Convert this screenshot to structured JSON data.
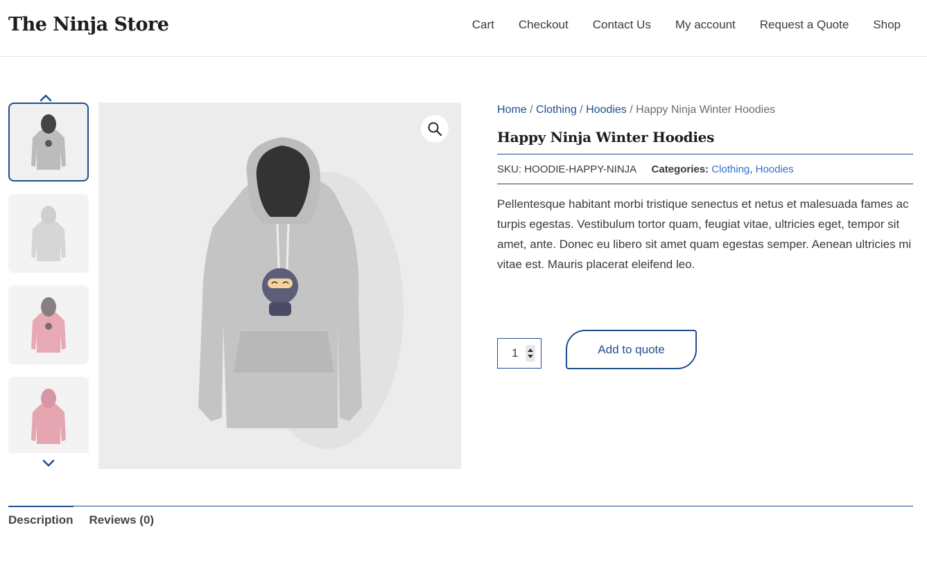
{
  "site": {
    "title": "The Ninja Store"
  },
  "nav": {
    "items": [
      "Cart",
      "Checkout",
      "Contact Us",
      "My account",
      "Request a Quote",
      "Shop"
    ]
  },
  "gallery": {
    "thumbnails": [
      {
        "color": "#bcbcbc",
        "hood": "#444444",
        "label": "grey hoodie with ninja"
      },
      {
        "color": "#d6d6d6",
        "hood": "#cfcfcf",
        "label": "grey hoodie back"
      },
      {
        "color": "#e8a8b4",
        "hood": "#8a7f80",
        "label": "pink hoodie with ninja"
      },
      {
        "color": "#e5a6b1",
        "hood": "#d796a3",
        "label": "pink hoodie back"
      }
    ],
    "main_hoodie_color": "#c4c4c4"
  },
  "breadcrumb": {
    "home": "Home",
    "clothing": "Clothing",
    "hoodies": "Hoodies",
    "current": "Happy Ninja Winter Hoodies",
    "sep": " / "
  },
  "product": {
    "title": "Happy Ninja Winter Hoodies",
    "sku_label": "SKU:",
    "sku": "HOODIE-HAPPY-NINJA",
    "categories_label": "Categories:",
    "categories": [
      "Clothing",
      "Hoodies"
    ],
    "categories_sep": ", ",
    "description": "Pellentesque habitant morbi tristique senectus et netus et malesuada fames ac turpis egestas. Vestibulum tortor quam, feugiat vitae, ultricies eget, tempor sit amet, ante. Donec eu libero sit amet quam egestas semper. Aenean ultricies mi vitae est. Mauris placerat eleifend leo.",
    "quantity": "1",
    "add_button": "Add to quote"
  },
  "tabs": [
    {
      "label": "Description",
      "active": true
    },
    {
      "label": "Reviews (0)",
      "active": false
    }
  ],
  "colors": {
    "accent": "#1f4e8c",
    "link": "#2f6fd1"
  }
}
